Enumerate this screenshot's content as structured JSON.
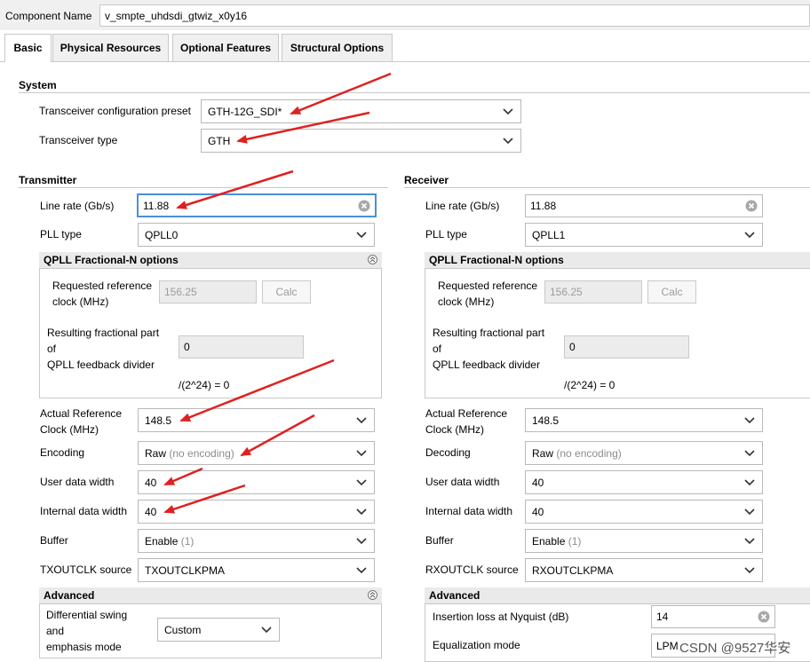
{
  "component": {
    "label": "Component Name",
    "value": "v_smpte_uhdsdi_gtwiz_x0y16"
  },
  "tabs": [
    {
      "label": "Basic",
      "active": true
    },
    {
      "label": "Physical Resources",
      "active": false
    },
    {
      "label": "Optional Features",
      "active": false
    },
    {
      "label": "Structural Options",
      "active": false
    }
  ],
  "system": {
    "title": "System",
    "preset_label": "Transceiver configuration preset",
    "preset_value": "GTH-12G_SDI*",
    "type_label": "Transceiver type",
    "type_value": "GTH"
  },
  "transmitter": {
    "title": "Transmitter",
    "line_rate_label": "Line rate (Gb/s)",
    "line_rate_value": "11.88",
    "pll_type_label": "PLL type",
    "pll_type_value": "QPLL0",
    "qpll_title": "QPLL Fractional-N options",
    "req_ref_label_1": "Requested reference",
    "req_ref_label_2": "clock (MHz)",
    "req_ref_value": "156.25",
    "calc_label": "Calc",
    "frac_label_1": "Resulting fractional part",
    "frac_label_2": "of",
    "frac_label_3": "QPLL feedback divider",
    "frac_value": "0",
    "frac_formula": "/(2^24) = 0",
    "actual_ref_label_1": "Actual Reference",
    "actual_ref_label_2": "Clock (MHz)",
    "actual_ref_value": "148.5",
    "encoding_label": "Encoding",
    "encoding_value": "Raw",
    "encoding_hint": "(no encoding)",
    "user_width_label": "User data width",
    "user_width_value": "40",
    "internal_width_label": "Internal data width",
    "internal_width_value": "40",
    "buffer_label": "Buffer",
    "buffer_value": "Enable",
    "buffer_hint": "(1)",
    "outclk_label": "TXOUTCLK source",
    "outclk_value": "TXOUTCLKPMA",
    "advanced_title": "Advanced",
    "diff_label_1": "Differential swing",
    "diff_label_2": "and",
    "diff_label_3": "emphasis mode",
    "diff_value": "Custom"
  },
  "receiver": {
    "title": "Receiver",
    "line_rate_label": "Line rate (Gb/s)",
    "line_rate_value": "11.88",
    "pll_type_label": "PLL type",
    "pll_type_value": "QPLL1",
    "qpll_title": "QPLL Fractional-N options",
    "req_ref_label_1": "Requested reference",
    "req_ref_label_2": "clock (MHz)",
    "req_ref_value": "156.25",
    "calc_label": "Calc",
    "frac_label_1": "Resulting fractional part",
    "frac_label_2": "of",
    "frac_label_3": "QPLL feedback divider",
    "frac_value": "0",
    "frac_formula": "/(2^24) = 0",
    "actual_ref_label_1": "Actual Reference",
    "actual_ref_label_2": "Clock (MHz)",
    "actual_ref_value": "148.5",
    "decoding_label": "Decoding",
    "decoding_value": "Raw",
    "decoding_hint": "(no encoding)",
    "user_width_label": "User data width",
    "user_width_value": "40",
    "internal_width_label": "Internal data width",
    "internal_width_value": "40",
    "buffer_label": "Buffer",
    "buffer_value": "Enable",
    "buffer_hint": "(1)",
    "outclk_label": "RXOUTCLK source",
    "outclk_value": "RXOUTCLKPMA",
    "advanced_title": "Advanced",
    "insertion_label": "Insertion loss at Nyquist (dB)",
    "insertion_value": "14",
    "equalization_label": "Equalization mode",
    "equalization_value": "LPM"
  },
  "watermark": "CSDN @9527华安",
  "colors": {
    "annotation_arrow": "#e02020",
    "focus_border": "#4a90d9",
    "group_header": "#eaeaea"
  }
}
